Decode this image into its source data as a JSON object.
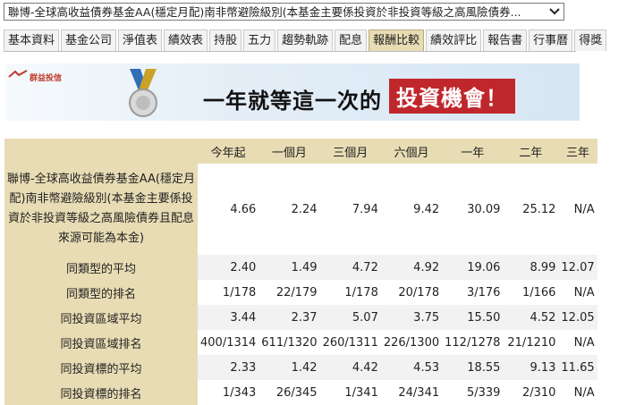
{
  "fund_select": {
    "selected": "聯博-全球高收益債券基金AA(穩定月配)南非幣避險級別(本基金主要係投資於非投資等級之高風險債券..."
  },
  "tabs": [
    {
      "label": "基本資料"
    },
    {
      "label": "基金公司"
    },
    {
      "label": "淨值表"
    },
    {
      "label": "績效表"
    },
    {
      "label": "持股"
    },
    {
      "label": "五力"
    },
    {
      "label": "趨勢軌跡"
    },
    {
      "label": "配息"
    },
    {
      "label": "報酬比較",
      "active": true
    },
    {
      "label": "績效評比"
    },
    {
      "label": "報告書"
    },
    {
      "label": "行事曆"
    },
    {
      "label": "得獎"
    }
  ],
  "banner": {
    "logo_text": "群益投信",
    "slogan": "一年就等這一次的",
    "slogan_highlight": "投資機會！"
  },
  "table": {
    "headers": [
      "",
      "今年起",
      "一個月",
      "三個月",
      "六個月",
      "一年",
      "二年",
      "三年"
    ],
    "fund_row": {
      "label": "聯博-全球高收益債券基金AA(穩定月配)南非幣避險級別(本基金主要係投資於非投資等級之高風險債券且配息來源可能為本金)",
      "values": [
        "4.66",
        "2.24",
        "7.94",
        "9.42",
        "30.09",
        "25.12",
        "N/A"
      ]
    },
    "rows": [
      {
        "label": "同類型的平均",
        "values": [
          "2.40",
          "1.49",
          "4.72",
          "4.92",
          "19.06",
          "8.99",
          "12.07"
        ]
      },
      {
        "label": "同類型的排名",
        "values": [
          "1/178",
          "22/179",
          "1/178",
          "20/178",
          "3/176",
          "1/166",
          "N/A"
        ]
      },
      {
        "label": "同投資區域平均",
        "values": [
          "3.44",
          "2.37",
          "5.07",
          "3.75",
          "15.50",
          "4.52",
          "12.05"
        ]
      },
      {
        "label": "同投資區域排名",
        "values": [
          "400/1314",
          "611/1320",
          "260/1311",
          "226/1300",
          "112/1278",
          "21/1210",
          "N/A"
        ]
      },
      {
        "label": "同投資標的平均",
        "values": [
          "2.33",
          "1.42",
          "4.42",
          "4.53",
          "18.55",
          "9.13",
          "11.65"
        ]
      },
      {
        "label": "同投資標的排名",
        "values": [
          "1/343",
          "26/345",
          "1/341",
          "24/341",
          "5/339",
          "2/310",
          "N/A"
        ]
      }
    ]
  }
}
